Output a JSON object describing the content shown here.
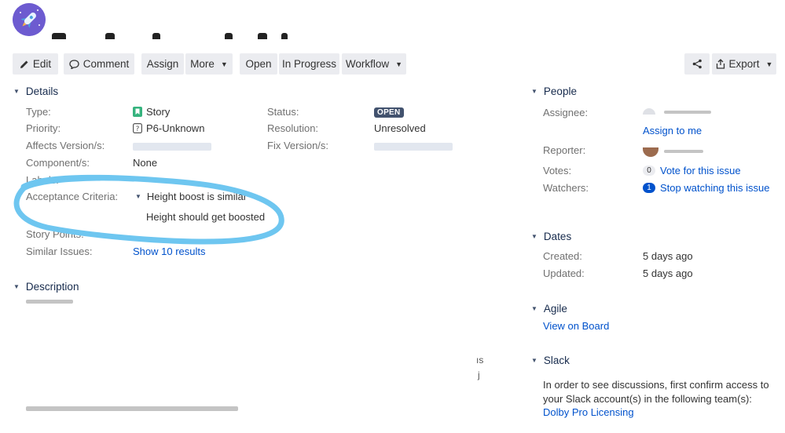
{
  "toolbar": {
    "edit": "Edit",
    "comment": "Comment",
    "assign": "Assign",
    "more": "More",
    "open": "Open",
    "in_progress": "In Progress",
    "workflow": "Workflow",
    "export": "Export"
  },
  "details": {
    "heading": "Details",
    "type_label": "Type:",
    "type_value": "Story",
    "priority_label": "Priority:",
    "priority_value": "P6-Unknown",
    "affects_label": "Affects Version/s:",
    "component_label": "Component/s:",
    "component_value": "None",
    "labels_label": "Labels:",
    "acceptance_label": "Acceptance Criteria:",
    "acceptance_item": "Height boost is similar",
    "acceptance_text": "Height should get boosted",
    "story_points_label": "Story Points:",
    "similar_label": "Similar Issues:",
    "similar_value": "Show 10 results",
    "status_label": "Status:",
    "status_value": "OPEN",
    "resolution_label": "Resolution:",
    "resolution_value": "Unresolved",
    "fix_label": "Fix Version/s:"
  },
  "description": {
    "heading": "Description",
    "fragment_1": "ıs",
    "fragment_2": "j"
  },
  "people": {
    "heading": "People",
    "assignee_label": "Assignee:",
    "assign_to_me": "Assign to me",
    "reporter_label": "Reporter:",
    "votes_label": "Votes:",
    "votes_count": "0",
    "vote_link": "Vote for this issue",
    "watchers_label": "Watchers:",
    "watchers_count": "1",
    "watch_link": "Stop watching this issue"
  },
  "dates": {
    "heading": "Dates",
    "created_label": "Created:",
    "created_value": "5 days ago",
    "updated_label": "Updated:",
    "updated_value": "5 days ago"
  },
  "agile": {
    "heading": "Agile",
    "board_link": "View on Board"
  },
  "slack": {
    "heading": "Slack",
    "text": "In order to see discussions, first confirm access to your Slack account(s) in the following team(s):",
    "team_link": "Dolby Pro Licensing"
  },
  "colors": {
    "accent": "#0052cc",
    "annotation": "#6ec6f0",
    "button_bg": "#ebecf0"
  }
}
